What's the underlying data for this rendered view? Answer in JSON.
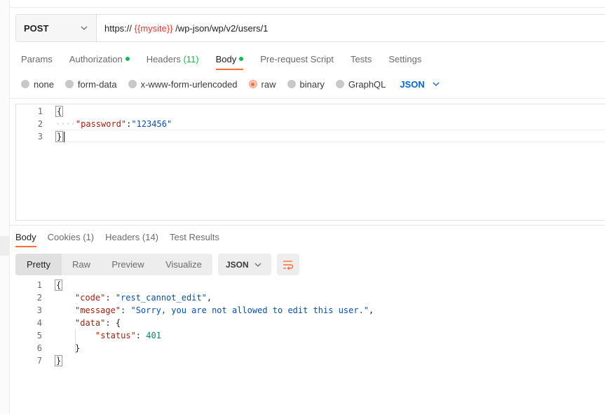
{
  "request": {
    "method": "POST",
    "url": {
      "prefix": "https:// ",
      "variable": "{{mysite}}",
      "suffix": " /wp-json/wp/v2/users/1"
    }
  },
  "request_tabs": [
    {
      "label": "Params",
      "dot": false,
      "count": ""
    },
    {
      "label": "Authorization",
      "dot": true,
      "count": ""
    },
    {
      "label": "Headers",
      "dot": false,
      "count": "(11)"
    },
    {
      "label": "Body",
      "dot": true,
      "count": ""
    },
    {
      "label": "Pre-request Script",
      "dot": false,
      "count": ""
    },
    {
      "label": "Tests",
      "dot": false,
      "count": ""
    },
    {
      "label": "Settings",
      "dot": false,
      "count": ""
    }
  ],
  "active_request_tab": "Body",
  "body_types": {
    "options": [
      "none",
      "form-data",
      "x-www-form-urlencoded",
      "raw",
      "binary",
      "GraphQL"
    ],
    "selected": "raw",
    "format": "JSON"
  },
  "request_body": {
    "line_numbers": [
      "1",
      "2",
      "3"
    ],
    "open_brace": "{",
    "whitespace": "····",
    "key": "\"password\"",
    "colon": ":",
    "value": "\"123456\"",
    "close_brace": "}"
  },
  "response_tabs": [
    {
      "label": "Body",
      "count": ""
    },
    {
      "label": "Cookies",
      "count": "(1)"
    },
    {
      "label": "Headers",
      "count": "(14)"
    },
    {
      "label": "Test Results",
      "count": ""
    }
  ],
  "active_response_tab": "Body",
  "view_modes": [
    "Pretty",
    "Raw",
    "Preview",
    "Visualize"
  ],
  "active_view_mode": "Pretty",
  "response_format": "JSON",
  "response_body": {
    "line_numbers": [
      "1",
      "2",
      "3",
      "4",
      "5",
      "6",
      "7"
    ],
    "open_brace": "{",
    "code_key": "\"code\"",
    "code_value": "\"rest_cannot_edit\"",
    "message_key": "\"message\"",
    "message_value": "\"Sorry, you are not allowed to edit this user.\"",
    "data_key": "\"data\"",
    "data_open": "{",
    "status_key": "\"status\"",
    "status_value": "401",
    "data_close": "}",
    "close_brace": "}",
    "colon_space": ": ",
    "comma": ","
  },
  "icons": {
    "method_dropdown": "chevron-down-icon",
    "format_dropdown": "chevron-down-icon",
    "wrap_lines": "wrap-lines-icon"
  },
  "colors": {
    "accent": "#ff6c37",
    "status_dot": "#0cbb52",
    "variable": "#e03a2e",
    "format_link": "#0265d2"
  }
}
